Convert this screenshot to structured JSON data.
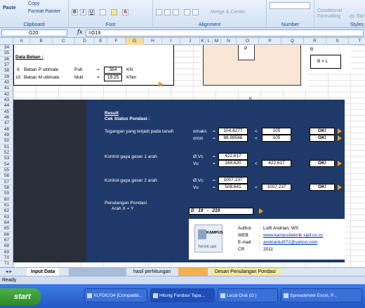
{
  "ribbon": {
    "paste": "Paste",
    "copy": "Copy",
    "format_painter": "Format Painter",
    "clipboard": "Clipboard",
    "font": "Font",
    "bold": "B",
    "italic": "I",
    "underline": "U",
    "font_color": "A",
    "alignment": "Alignment",
    "merge_center": "Merge & Center",
    "number": "Number",
    "conditional": "Conditional",
    "formatting": "Formatting",
    "styles": "Styles",
    "as_table": "as Tab"
  },
  "formula_bar": {
    "cell": "G20",
    "fx": "fx",
    "formula": "=G19"
  },
  "columns": [
    {
      "label": "A"
    },
    {
      "label": "B"
    },
    {
      "label": "C"
    },
    {
      "label": "D"
    },
    {
      "label": "E"
    },
    {
      "label": "F"
    },
    {
      "label": "G"
    },
    {
      "label": "H"
    },
    {
      "label": "I"
    },
    {
      "label": "J"
    },
    {
      "label": "K"
    },
    {
      "label": "L"
    },
    {
      "label": "M"
    },
    {
      "label": "N"
    },
    {
      "label": "O"
    },
    {
      "label": "P"
    },
    {
      "label": "Q"
    },
    {
      "label": "R"
    },
    {
      "label": "S"
    },
    {
      "label": "T"
    }
  ],
  "rows": [
    "34",
    "35",
    "36",
    "37",
    "38",
    "39",
    "40",
    "41",
    "42",
    "43",
    "44",
    "45",
    "46",
    "47",
    "48",
    "49",
    "50",
    "51",
    "52",
    "53",
    "54",
    "55",
    "56",
    "57",
    "58",
    "59",
    "60",
    "61",
    "62",
    "63",
    "64",
    "65",
    "66",
    "67",
    "68",
    "69",
    "70",
    "71"
  ],
  "load": {
    "title": "Data Beban :",
    "row1_no": "9",
    "row1_label": "Beban P ultimate",
    "row1_sym": "Pult",
    "row1_eq": "=",
    "row1_val": "384",
    "row1_unit": "KN",
    "row2_no": "10",
    "row2_label": "Beban M ultimate",
    "row2_sym": "Mult",
    "row2_eq": "=",
    "row2_val": "18,25",
    "row2_unit": "KNm"
  },
  "diagram": {
    "b_label": "b",
    "B_label": "B",
    "BL_label": "B = L",
    "P_label": "P"
  },
  "result": {
    "title": "Result",
    "subtitle": "Cek Status Pondasi :",
    "tegangan_label": "Tegangan yang terjadi pada tanah",
    "smax_sym": "σmaks",
    "smax_eq": "=",
    "smax_val": "104,8277",
    "smax_lt": "<",
    "smax_lim": "105",
    "smax_ok": "OK!",
    "smin_sym": "σmin",
    "smin_eq": "=",
    "smin_val": "88,98566",
    "smin_lt": "<",
    "smin_lim": "105",
    "smin_ok": "OK!",
    "geser1_label": "Kontrol gaya geser 1 arah",
    "g1_vc_sym": "Ø.Vc",
    "g1_vc_eq": "=",
    "g1_vc_val": "422,617",
    "g1_vu_sym": "Vu",
    "g1_vu_eq": "=",
    "g1_vu_val": "168,620",
    "g1_lt": "<",
    "g1_lim": "422,617",
    "g1_ok": "OK!",
    "geser2_label": "Kontrol gaya geser 2 arah",
    "g2_vc_sym": "Ø.Vc",
    "g2_vc_eq": "=",
    "g2_vc_val": "1007,237",
    "g2_vu_sym": "Vu",
    "g2_vu_eq": "=",
    "g2_vu_val": "508,641",
    "g2_lt": "<",
    "g2_lim": "1007,237",
    "g2_ok": "OK!",
    "tul_label": "Penulangan Pondasi",
    "tul_sub": "Arah X = Y",
    "tul_d": "D",
    "tul_dia": "19",
    "tul_dash": "-",
    "tul_spacing": "219"
  },
  "author": {
    "author_key": "Author",
    "author_val": "Lutfi Andrian, WS",
    "web_key": "WEB",
    "web_val": "www.kampusteknik sipil.co.cc",
    "email_key": "E-mail",
    "email_val": "andrianlutfi72@yahoo.com",
    "cr_key": "CR",
    "cr_val": "2011",
    "logo_text": "KAMPUS",
    "logo_sub": "TeKniK sipil"
  },
  "sheet_tabs": [
    "Input Data",
    "",
    "hasil perhitungan",
    "",
    "Desan Penulangan Pondasi"
  ],
  "status": "Ready",
  "taskbar": {
    "start": "start",
    "tasks": [
      "XLFDICO4 [Compatibi...",
      "Hitung Fondasi Tapa...",
      "Local Disk (D:)",
      "Spreadsheet Excel, P..."
    ]
  }
}
